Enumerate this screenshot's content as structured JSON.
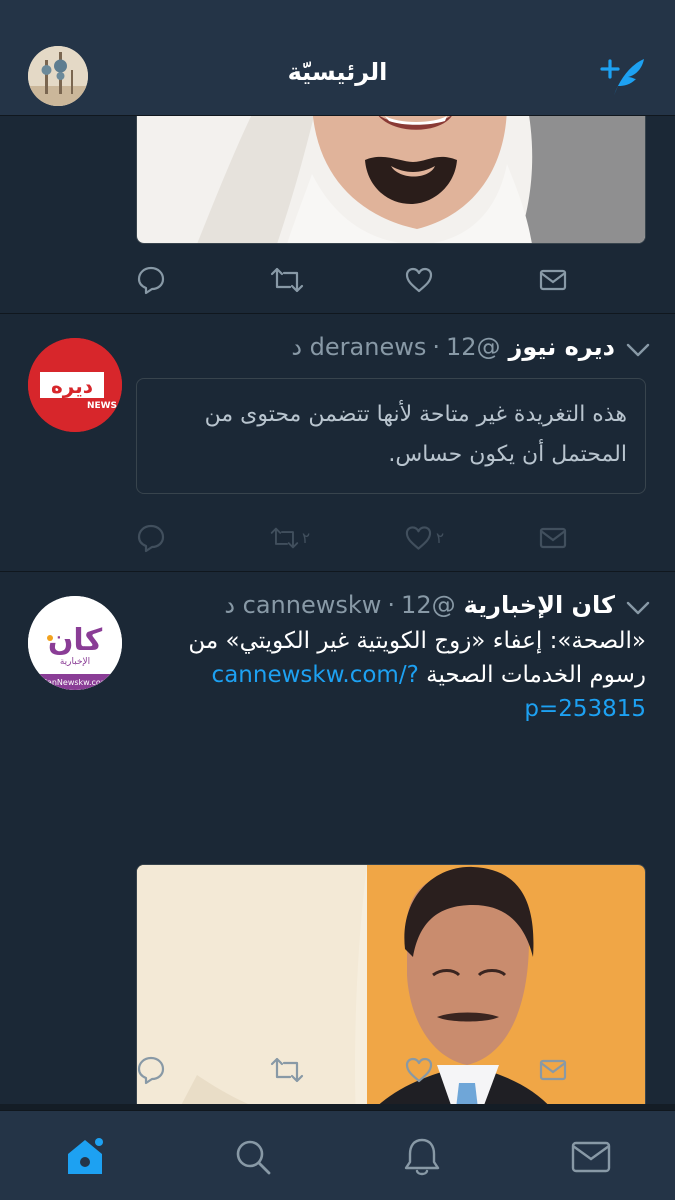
{
  "header": {
    "title": "الرئيسيّة"
  },
  "tweets": [
    {
      "id": "top",
      "actions": {
        "reply": "",
        "retweet": "",
        "like": ""
      }
    },
    {
      "id": "deranews",
      "avatar_text": "ديره",
      "avatar_sub": "NEWS",
      "name": "ديره نيوز",
      "handle": "@deranews",
      "time": "12 د",
      "notice": "هذه التغريدة غير متاحة لأنها تتضمن محتوى من المحتمل أن يكون حساس.",
      "actions": {
        "reply": "",
        "retweet": "٢",
        "like": "٢"
      }
    },
    {
      "id": "cannewskw",
      "avatar_text": "كان",
      "avatar_sub": "الإخبارية",
      "avatar_url": "CanNewskw.com",
      "name": "كان الإخبارية",
      "handle": "@cannewskw",
      "time": "12 د",
      "text": "«الصحة»: إعفاء «زوج الكويتية غير الكويتي» من رسوم الخدمات الصحية",
      "link": "cannewskw.com/?p=253815",
      "actions": {
        "reply": "",
        "retweet": "",
        "like": ""
      }
    }
  ],
  "colors": {
    "accent": "#1da1f2",
    "background": "#1b2836",
    "header": "#243447",
    "muted": "#8899a6"
  },
  "tabs": [
    "home-icon",
    "search-icon",
    "notifications-icon",
    "messages-icon"
  ]
}
